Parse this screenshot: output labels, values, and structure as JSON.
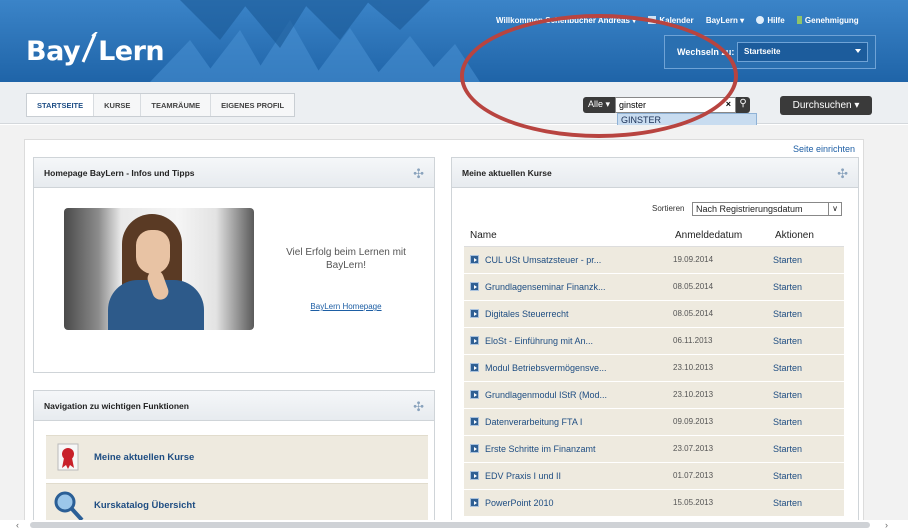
{
  "brand": {
    "logo": "Bay/Lern",
    "logo_left": "Bay",
    "logo_right": "Lern"
  },
  "topnav": {
    "welcome": "Willkommen Schenbucher Andreas ▾",
    "calendar": "Kalender",
    "baylern": "BayLern ▾",
    "help": "Hilfe",
    "approval": "Genehmigung"
  },
  "switch": {
    "label": "Wechseln zu:",
    "value": "Startseite"
  },
  "tabs": [
    "STARTSEITE",
    "KURSE",
    "TEAMRÄUME",
    "EIGENES PROFIL"
  ],
  "search": {
    "filter": "Alle ▾",
    "query": "ginster",
    "suggestion": "GINSTER",
    "button": "Durchsuchen ▾"
  },
  "page": {
    "setup_link": "Seite einrichten"
  },
  "panel_home": {
    "title": "Homepage BayLern - Infos und Tipps",
    "welcome": "Viel Erfolg beim Lernen mit BayLern!",
    "link": "BayLern Homepage"
  },
  "panel_nav": {
    "title": "Navigation zu wichtigen Funktionen",
    "items": [
      {
        "label": "Meine aktuellen Kurse",
        "icon": "award-ribbon-icon"
      },
      {
        "label": "Kurskatalog Übersicht",
        "icon": "magnifier-icon"
      }
    ]
  },
  "panel_courses": {
    "title": "Meine aktuellen Kurse",
    "sort_label": "Sortieren",
    "sort_value": "Nach Registrierungsdatum",
    "columns": [
      "Name",
      "Anmeldedatum",
      "Aktionen"
    ],
    "rows": [
      {
        "name": "CUL USt Umsatzsteuer - pr...",
        "date": "19.09.2014",
        "action": "Starten"
      },
      {
        "name": "Grundlagenseminar Finanzk...",
        "date": "08.05.2014",
        "action": "Starten"
      },
      {
        "name": "Digitales Steuerrecht",
        "date": "08.05.2014",
        "action": "Starten"
      },
      {
        "name": "EloSt - Einführung mit An...",
        "date": "06.11.2013",
        "action": "Starten"
      },
      {
        "name": "Modul Betriebsvermögensve...",
        "date": "23.10.2013",
        "action": "Starten"
      },
      {
        "name": "Grundlagenmodul IStR (Mod...",
        "date": "23.10.2013",
        "action": "Starten"
      },
      {
        "name": "Datenverarbeitung FTA I",
        "date": "09.09.2013",
        "action": "Starten"
      },
      {
        "name": "Erste Schritte im Finanzamt",
        "date": "23.07.2013",
        "action": "Starten"
      },
      {
        "name": "EDV Praxis I und II",
        "date": "01.07.2013",
        "action": "Starten"
      },
      {
        "name": "PowerPoint 2010",
        "date": "15.05.2013",
        "action": "Starten"
      }
    ]
  },
  "colors": {
    "header": "#2a6fb0",
    "link": "#1e4d82",
    "row_bg": "#eeeadf",
    "annotation": "#b84440"
  }
}
